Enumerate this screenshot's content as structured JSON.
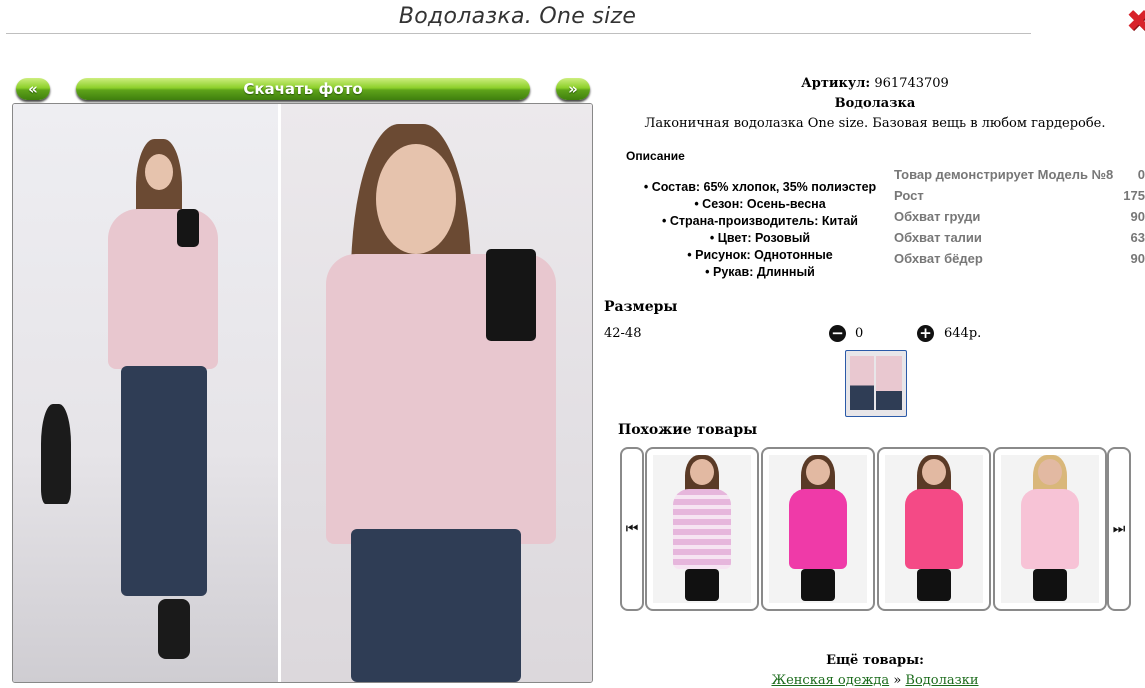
{
  "page": {
    "title": "Водолазка. One size",
    "close_icon": "close-icon"
  },
  "gallery": {
    "prev_label": "«",
    "download_label": "Скачать фото",
    "next_label": "»"
  },
  "product": {
    "article_label": "Артикул:",
    "article_value": "961743709",
    "name": "Водолазка",
    "description": "Лаконичная водолазка One size. Базовая вещь в любом гардеробе."
  },
  "description_section": {
    "heading": "Описание",
    "items": [
      "Состав: 65% хлопок, 35% полиэстер",
      "Сезон: Осень-весна",
      "Страна-производитель: Китай",
      "Цвет: Розовый",
      "Рисунок: Однотонные",
      "Рукав: Длинный"
    ]
  },
  "model_info": {
    "rows": [
      {
        "label": "Товар демонстрирует Модель №8",
        "value": "0"
      },
      {
        "label": "Рост",
        "value": "175"
      },
      {
        "label": "Обхват груди",
        "value": "90"
      },
      {
        "label": "Обхват талии",
        "value": "63"
      },
      {
        "label": "Обхват бёдер",
        "value": "90"
      }
    ]
  },
  "sizes": {
    "heading": "Размеры",
    "range": "42-48",
    "quantity": "0",
    "price": "644р."
  },
  "similar": {
    "heading": "Похожие товары",
    "items": [
      {
        "color": "#e6b6dc",
        "stripe": "#f6e4f2"
      },
      {
        "color": "#ef3aa8",
        "stripe": "#ef3aa8"
      },
      {
        "color": "#f44a86",
        "stripe": "#f44a86"
      },
      {
        "color": "#f7c3d6",
        "stripe": "#f7c3d6"
      }
    ]
  },
  "more": {
    "heading": "Ещё товары:",
    "crumb_1": "Женская одежда",
    "separator": "»",
    "crumb_2": "Водолазки"
  }
}
